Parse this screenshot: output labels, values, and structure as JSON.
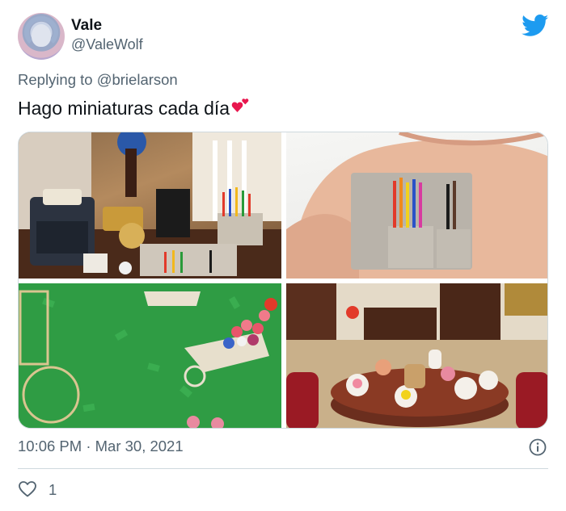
{
  "user": {
    "display_name": "Vale",
    "handle": "@ValeWolf",
    "avatar": "avatar-image"
  },
  "header": {
    "logo_icon": "twitter-bird-icon",
    "brand_color": "#1d9bf0"
  },
  "reply": {
    "prefix": "Replying to ",
    "mention": "@brielarson"
  },
  "tweet": {
    "text": "Hago miniaturas cada día",
    "emoji": "two-hearts-emoji"
  },
  "media": {
    "photos": [
      "miniature-desk-typewriter-camera-pencils",
      "miniature-pencil-case-in-hand",
      "miniature-garden-bicycle-flower-cart",
      "miniature-dining-room-tea-set"
    ]
  },
  "meta": {
    "timestamp": "10:06 PM · Mar 30, 2021",
    "info_icon": "info-icon"
  },
  "actions": {
    "like_icon": "heart-outline-icon",
    "like_count": "1"
  }
}
